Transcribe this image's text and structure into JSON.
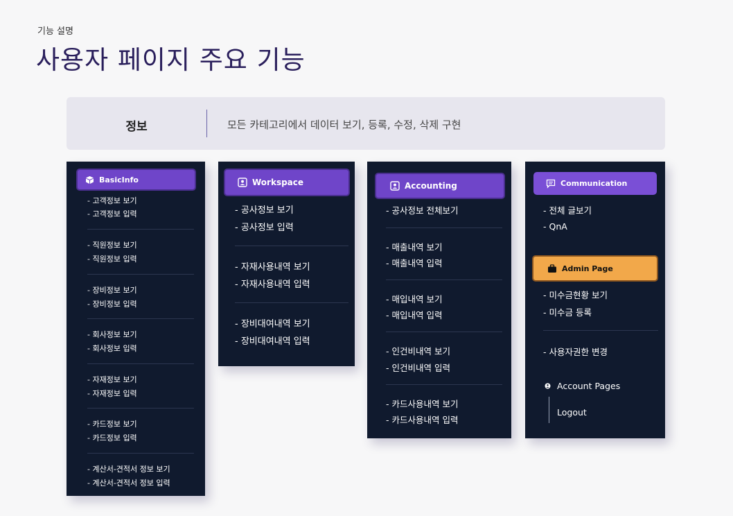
{
  "page": {
    "subtitle": "기능 설명",
    "title": "사용자 페이지 주요 기능"
  },
  "banner": {
    "label": "정보",
    "description": "모든 카테고리에서 데이터 보기, 등록, 수정, 삭제 구현"
  },
  "basicinfo": {
    "header": "BasicInfo",
    "icon": "cube-icon",
    "items": [
      "- 고객정보 보기",
      "- 고객정보 입력",
      "- 직원정보 보기",
      "- 직원정보 입력",
      "- 장비정보 보기",
      "- 장비정보 입력",
      "- 회사정보 보기",
      "- 회사정보 입력",
      "- 자재정보 보기",
      "- 자재정보 입력",
      "- 카드정보 보기",
      "- 카드정보 입력",
      "- 계산서-견적서 정보 보기",
      "- 계산서-견적서 정보 입력"
    ]
  },
  "workspace": {
    "header": "Workspace",
    "icon": "user-badge-icon",
    "items": [
      "- 공사정보 보기",
      "- 공사정보 입력",
      "- 자재사용내역 보기",
      "- 자재사용내역 입력",
      "- 장비대여내역 보기",
      "- 장비대여내역 입력"
    ]
  },
  "accounting": {
    "header": "Accounting",
    "icon": "user-badge-icon",
    "items": [
      "- 공사정보 전체보기",
      "- 매출내역 보기",
      "- 매출내역 입력",
      "- 매입내역 보기",
      "- 매입내역 입력",
      "- 인건비내역 보기",
      "- 인건비내역 입력",
      "- 카드사용내역 보기",
      "- 카드사용내역 입력"
    ]
  },
  "communication": {
    "header": "Communication",
    "icon": "message-icon",
    "items": [
      "- 전체 글보기",
      "- QnA"
    ]
  },
  "admin": {
    "header": "Admin Page",
    "icon": "briefcase-icon",
    "items": [
      "- 미수금현황 보기",
      "- 미수금 등록",
      "- 사용자권한 변경"
    ]
  },
  "account_pages": {
    "label": "Account Pages",
    "icon": "user-dot-icon",
    "logout": "Logout"
  },
  "colors": {
    "panel_bg": "#101a2e",
    "header_purple": "#6f45c9",
    "admin_orange": "#f2a84a",
    "title": "#2a1f5c"
  }
}
